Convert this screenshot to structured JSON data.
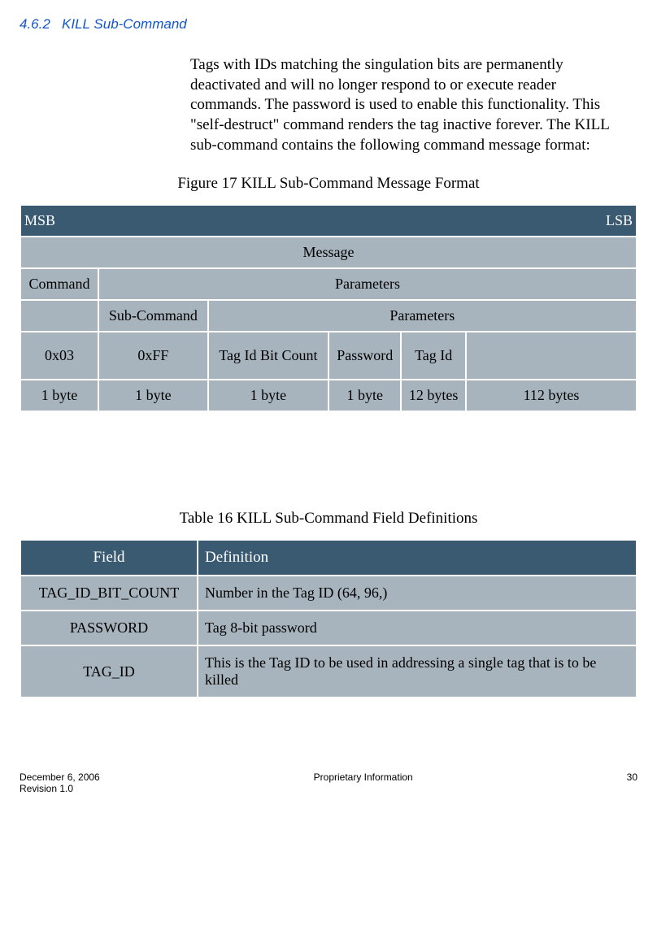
{
  "section": {
    "number": "4.6.2",
    "title": "KILL Sub-Command"
  },
  "body_paragraph": "Tags with IDs matching the singulation bits are permanently deactivated and will no longer respond to or execute reader commands.  The password is used to enable this functionality.  This \"self-destruct\" command renders the tag inactive forever.  The KILL sub-command contains the following command message format:",
  "figure_caption": "Figure 17 KILL Sub-Command Message Format",
  "msg_table": {
    "msb": "MSB",
    "lsb": "LSB",
    "message": "Message",
    "command": "Command",
    "parameters_top": "Parameters",
    "sub_command": "Sub-Command",
    "parameters_sub": "Parameters",
    "values": {
      "c0": "0x03",
      "c1": "0xFF",
      "c2": "Tag Id Bit Count",
      "c3": "Password",
      "c4": "Tag Id",
      "c5": ""
    },
    "sizes": {
      "s0": "1 byte",
      "s1": "1 byte",
      "s2": "1 byte",
      "s3": "1 byte",
      "s4": "12 bytes",
      "s5": "112 bytes"
    }
  },
  "table_caption": "Table 16 KILL Sub-Command Field Definitions",
  "def_table": {
    "headers": {
      "field": "Field",
      "definition": "Definition"
    },
    "rows": [
      {
        "field": "TAG_ID_BIT_COUNT",
        "definition": "Number in the Tag ID (64, 96,)"
      },
      {
        "field": "PASSWORD",
        "definition": "Tag 8-bit password"
      },
      {
        "field": "TAG_ID",
        "definition": "This is the Tag ID to be used in addressing a single tag that is to be killed"
      }
    ]
  },
  "footer": {
    "date": "December 6, 2006",
    "revision": "Revision 1.0",
    "center": "Proprietary Information",
    "page": "30"
  }
}
